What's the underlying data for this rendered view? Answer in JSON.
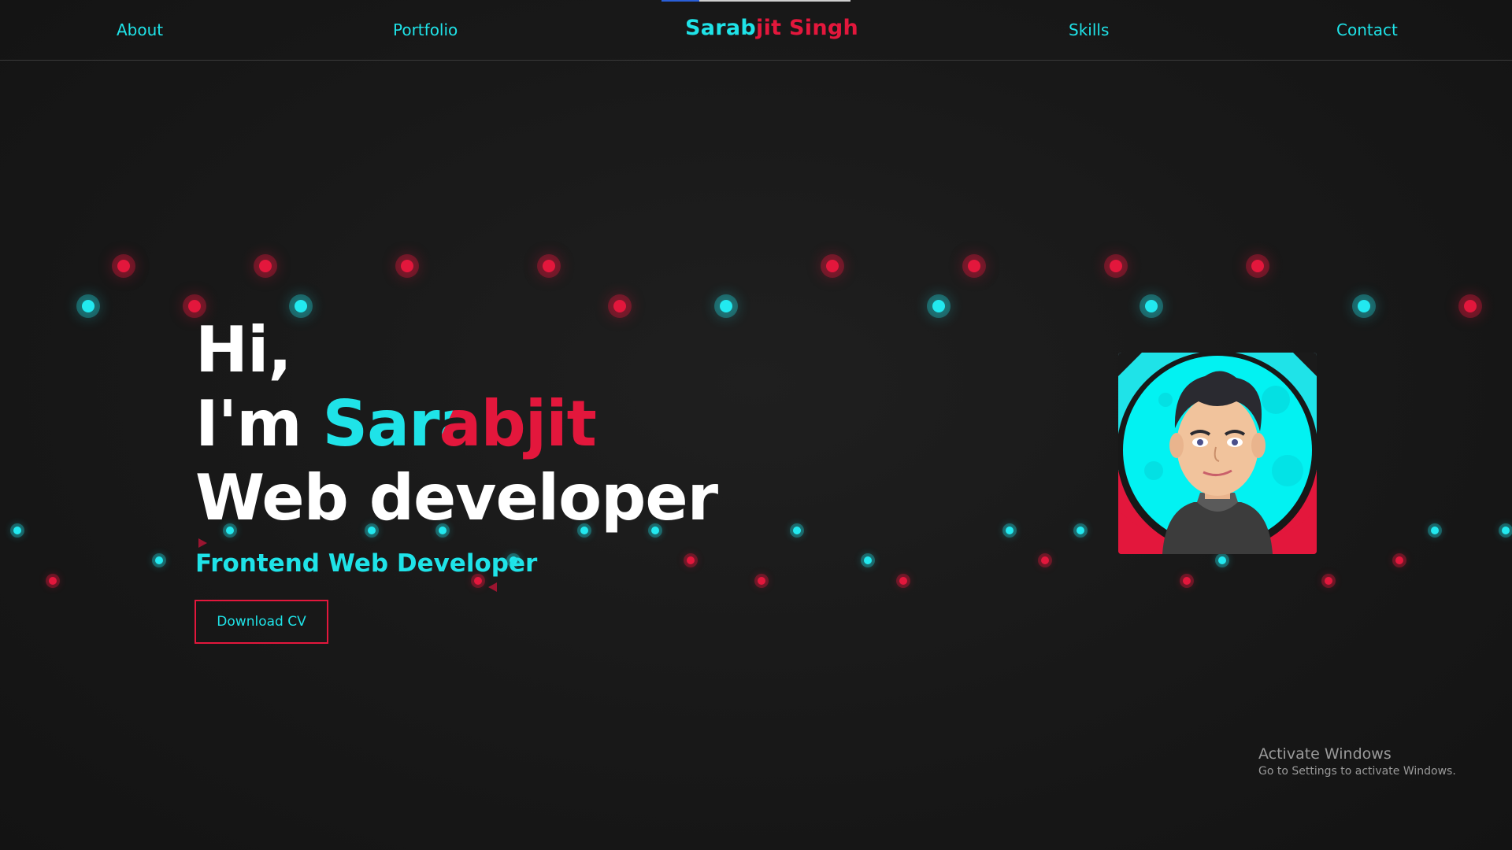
{
  "nav": {
    "links": [
      {
        "label": "About"
      },
      {
        "label": "Portfolio"
      },
      {
        "label": "Skills"
      },
      {
        "label": "Contact"
      }
    ],
    "brand_part1": "Sarab",
    "brand_part2": "jit Singh"
  },
  "hero": {
    "greeting": "Hi,",
    "intro_prefix": "I'm ",
    "name": "Sarabjit",
    "role_line": "Web developer",
    "subtitle": "Frontend Web Developer",
    "cv_button_label": "Download CV"
  },
  "colors": {
    "accent_cyan": "#1fe3e8",
    "accent_red": "#e3173c",
    "background": "#171717"
  },
  "watermark": {
    "title": "Activate Windows",
    "subtitle": "Go to Settings to activate Windows."
  }
}
